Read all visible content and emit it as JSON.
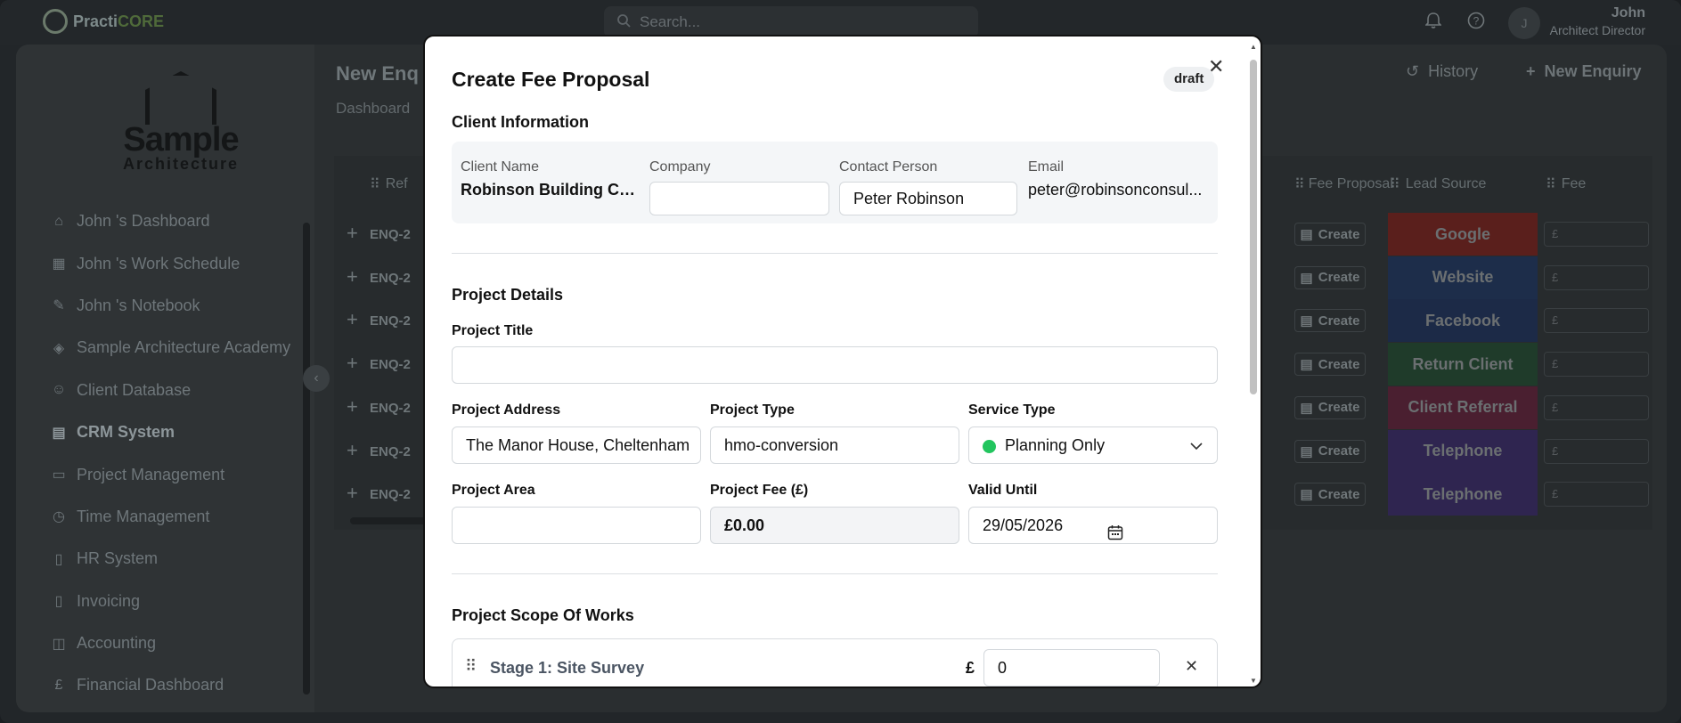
{
  "app": {
    "brand_1": "Practi",
    "brand_2": "CORE"
  },
  "search": {
    "placeholder": "Search..."
  },
  "user": {
    "initial": "J",
    "name": "John",
    "role": "Architect Director"
  },
  "sidebar": {
    "brand_line1": "Sample",
    "brand_line2": "Architecture",
    "items": [
      {
        "label": "John 's Dashboard",
        "icon": "home-icon"
      },
      {
        "label": "John 's Work Schedule",
        "icon": "calendar-icon"
      },
      {
        "label": "John 's Notebook",
        "icon": "notebook-icon"
      },
      {
        "label": "Sample Architecture Academy",
        "icon": "graduation-cap-icon"
      },
      {
        "label": "Client Database",
        "icon": "users-icon"
      },
      {
        "label": "CRM System",
        "icon": "building-icon"
      },
      {
        "label": "Project Management",
        "icon": "folder-icon"
      },
      {
        "label": "Time Management",
        "icon": "clock-icon"
      },
      {
        "label": "HR System",
        "icon": "file-icon"
      },
      {
        "label": "Invoicing",
        "icon": "invoice-icon"
      },
      {
        "label": "Accounting",
        "icon": "book-icon"
      },
      {
        "label": "Financial Dashboard",
        "icon": "pound-icon"
      }
    ]
  },
  "page": {
    "title": "New Enq",
    "breadcrumb": "Dashboard",
    "history_label": "History",
    "new_enquiry_label": "New Enquiry"
  },
  "table": {
    "headers": {
      "ref": "Ref",
      "fee_proposal": "Fee Proposal",
      "lead_source": "Lead Source",
      "fee": "Fee"
    },
    "rows": [
      {
        "ref": "ENQ-2",
        "fp": "Create",
        "source": "Google",
        "source_color": "#5a1f1c",
        "fee": "£"
      },
      {
        "ref": "ENQ-2",
        "fp": "Create",
        "source": "Website",
        "source_color": "#1d2d4a",
        "fee": "£"
      },
      {
        "ref": "ENQ-2",
        "fp": "Create",
        "source": "Facebook",
        "source_color": "#1c2a47",
        "fee": "£"
      },
      {
        "ref": "ENQ-2",
        "fp": "Create",
        "source": "Return Client",
        "source_color": "#1f3b2a",
        "fee": "£"
      },
      {
        "ref": "ENQ-2",
        "fp": "Create",
        "source": "Client Referral",
        "source_color": "#4a1f30",
        "fee": "£"
      },
      {
        "ref": "ENQ-2",
        "fp": "Create",
        "source": "Telephone",
        "source_color": "#2f2550",
        "fee": "£"
      },
      {
        "ref": "ENQ-2",
        "fp": "Create",
        "source": "Telephone",
        "source_color": "#2f2550",
        "fee": "£"
      }
    ]
  },
  "modal": {
    "title": "Create Fee Proposal",
    "status_badge": "draft",
    "client_section": "Client Information",
    "client": {
      "name_label": "Client Name",
      "name_value": "Robinson Building Co...",
      "company_label": "Company",
      "company_value": "",
      "contact_label": "Contact Person",
      "contact_value": "Peter Robinson",
      "email_label": "Email",
      "email_value": "peter@robinsonconsul..."
    },
    "project_section": "Project Details",
    "project": {
      "title_label": "Project Title",
      "title_value": "",
      "address_label": "Project Address",
      "address_value": "The Manor House, Cheltenham",
      "type_label": "Project Type",
      "type_value": "hmo-conversion",
      "service_label": "Service Type",
      "service_value": "Planning Only",
      "area_label": "Project Area",
      "area_value": "",
      "fee_label": "Project Fee (£)",
      "fee_value": "£0.00",
      "valid_label": "Valid Until",
      "valid_value": "29/05/2026"
    },
    "scope_section": "Project Scope Of Works",
    "stages": [
      {
        "name": "Stage 1: Site Survey",
        "currency": "£",
        "amount": "0"
      }
    ]
  }
}
